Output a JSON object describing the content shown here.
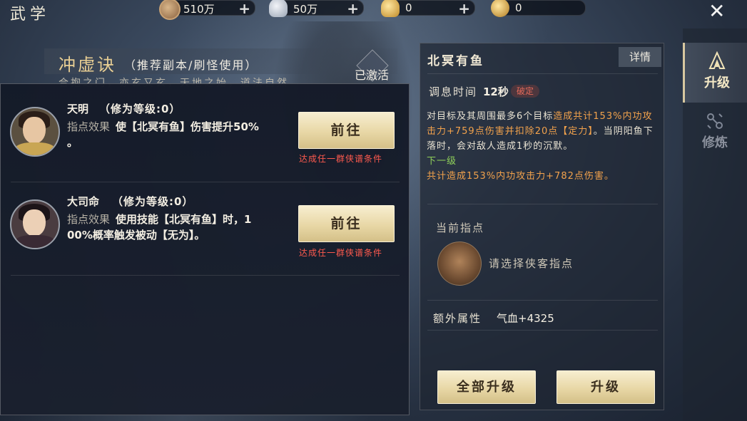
{
  "header": {
    "title": "武学",
    "close_icon": "close-icon"
  },
  "currencies": [
    {
      "icon": "copper-coin-icon",
      "value": "510万"
    },
    {
      "icon": "silver-ingot-icon",
      "value": "50万"
    },
    {
      "icon": "gold-ingot-icon",
      "value": "0"
    },
    {
      "icon": "bound-gold-icon",
      "value": "0"
    }
  ],
  "side_tabs": [
    {
      "label": "升级",
      "icon": "upgrade-arrow-icon",
      "active": true
    },
    {
      "label": "修炼",
      "icon": "cultivate-icon",
      "active": false
    }
  ],
  "skill": {
    "name": "冲虚诀",
    "recommend": "（推荐副本/刷怪使用）",
    "status": "已激活",
    "hint": "合抱之门，亦玄又玄，天地之始，道法自然"
  },
  "popup": {
    "effect_label": "指点效果",
    "goto_label": "前往",
    "condition": "达成任一群侠谱条件",
    "characters": [
      {
        "name": "天明",
        "level": "（修为等级:0）",
        "effect_line1": "使【北冥有鱼】伤害提升50%",
        "effect_line2": "。"
      },
      {
        "name": "大司命",
        "level": "（修为等级:0）",
        "effect_line1": "使用技能【北冥有鱼】时，1",
        "effect_line2": "00%概率触发被动【无为】。"
      }
    ]
  },
  "panel": {
    "title": "北冥有鱼",
    "detail_button": "详情",
    "cooldown_label": "调息时间",
    "cooldown_value": "12秒",
    "tag": "破定",
    "desc": {
      "p1": "对目标及其周围最多6个目标",
      "p2": "造成共计153%内功攻击力+759点伤害并扣除20点【定力】",
      "p3": "。当阴阳鱼下落时，会对敌人造成1秒的沉默。",
      "next_label": "下一级",
      "next_text": "共计造成153%内功攻击力+782点伤害。"
    },
    "current_guide_label": "当前指点",
    "pick_text": "请选择侠客指点",
    "extra_label": "额外属性",
    "extra_value": "气血+4325",
    "upgrade_all": "全部升级",
    "upgrade": "升级"
  }
}
